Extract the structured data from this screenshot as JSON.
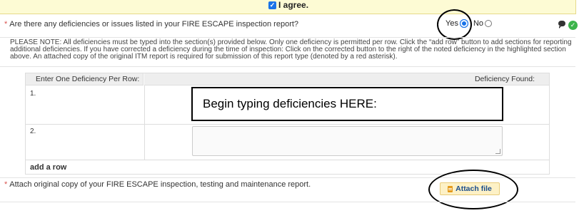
{
  "agree": {
    "checked": true,
    "label": "I agree."
  },
  "question_deficiencies": {
    "required_marker": "*",
    "text": "Are there any deficiencies or issues listed in your FIRE ESCAPE inspection report?",
    "yes_label": "Yes",
    "no_label": "No",
    "selected": "Yes"
  },
  "note": "PLEASE NOTE: All deficiencies must be typed into the section(s) provided below. Only one deficiency is permitted per row. Click the “add row” button to add sections for reporting additional deficiencies. If you have corrected a deficiency during the time of inspection: Click on the corrected button to the right of the noted deficiency in the highlighted section above. An attached copy of the original ITM report is required for submission of this report type (denoted by a red asterisk).",
  "table": {
    "col1_header": "Enter One Deficiency Per Row:",
    "col2_header": "Deficiency Found:",
    "rows": [
      {
        "num": "1.",
        "value": ""
      },
      {
        "num": "2.",
        "value": ""
      }
    ],
    "overlay_text": "Begin typing deficiencies HERE:",
    "add_row_label": "add a row"
  },
  "question_attach": {
    "required_marker": "*",
    "text": "Attach original copy of your FIRE ESCAPE inspection, testing and maintenance report.",
    "button_label": "Attach file"
  },
  "colors": {
    "accent": "#1a73e8",
    "required": "#d9534f",
    "attach_bg": "#fdf1c6",
    "agree_bg": "#fdfbd4"
  }
}
